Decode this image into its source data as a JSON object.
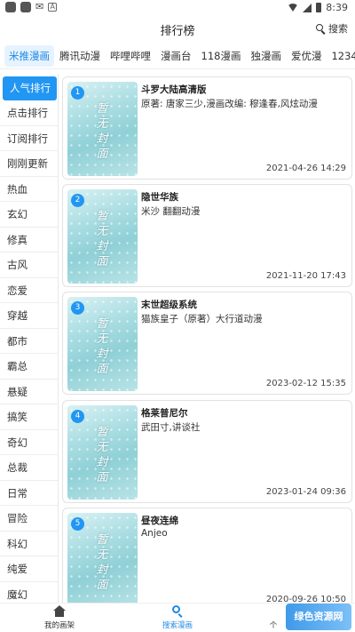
{
  "status_bar": {
    "time": "8:39"
  },
  "header": {
    "title": "排行榜",
    "search_label": "搜索"
  },
  "site_tabs": [
    {
      "label": "米推漫画",
      "active": true
    },
    {
      "label": "腾讯动漫",
      "active": false
    },
    {
      "label": "哔哩哔哩",
      "active": false
    },
    {
      "label": "漫画台",
      "active": false
    },
    {
      "label": "118漫画",
      "active": false
    },
    {
      "label": "独漫画",
      "active": false
    },
    {
      "label": "爱优漫",
      "active": false
    },
    {
      "label": "1234",
      "active": false
    }
  ],
  "sidebar": {
    "items": [
      {
        "label": "人气排行",
        "active": true
      },
      {
        "label": "点击排行"
      },
      {
        "label": "订阅排行"
      },
      {
        "label": "刚刚更新"
      },
      {
        "label": "热血"
      },
      {
        "label": "玄幻"
      },
      {
        "label": "修真"
      },
      {
        "label": "古风"
      },
      {
        "label": "恋爱"
      },
      {
        "label": "穿越"
      },
      {
        "label": "都市"
      },
      {
        "label": "霸总"
      },
      {
        "label": "悬疑"
      },
      {
        "label": "搞笑"
      },
      {
        "label": "奇幻"
      },
      {
        "label": "总裁"
      },
      {
        "label": "日常"
      },
      {
        "label": "冒险"
      },
      {
        "label": "科幻"
      },
      {
        "label": "纯爱"
      },
      {
        "label": "魔幻"
      }
    ]
  },
  "cover_placeholder_text": "暂无封面",
  "comics": [
    {
      "rank": "1",
      "title": "斗罗大陆高清版",
      "author": "原著: 唐家三少,漫画改编: 穆逢春,风炫动漫",
      "date": "2021-04-26 14:29"
    },
    {
      "rank": "2",
      "title": "隐世华族",
      "author": "米沙 翻翻动漫",
      "date": "2021-11-20 17:43"
    },
    {
      "rank": "3",
      "title": "末世超级系统",
      "author": "猫族皇子（原著）大行道动漫",
      "date": "2023-02-12 15:35"
    },
    {
      "rank": "4",
      "title": "格莱普尼尔",
      "author": "武田寸,讲谈社",
      "date": "2023-01-24 09:36"
    },
    {
      "rank": "5",
      "title": "昼夜连绵",
      "author": "Anjeo",
      "date": "2020-09-26 10:50"
    }
  ],
  "bottom_nav": {
    "bookshelf_label": "我的画架",
    "search_label": "搜索漫画",
    "third_label": "个",
    "watermark_text": "绿色资源网"
  }
}
